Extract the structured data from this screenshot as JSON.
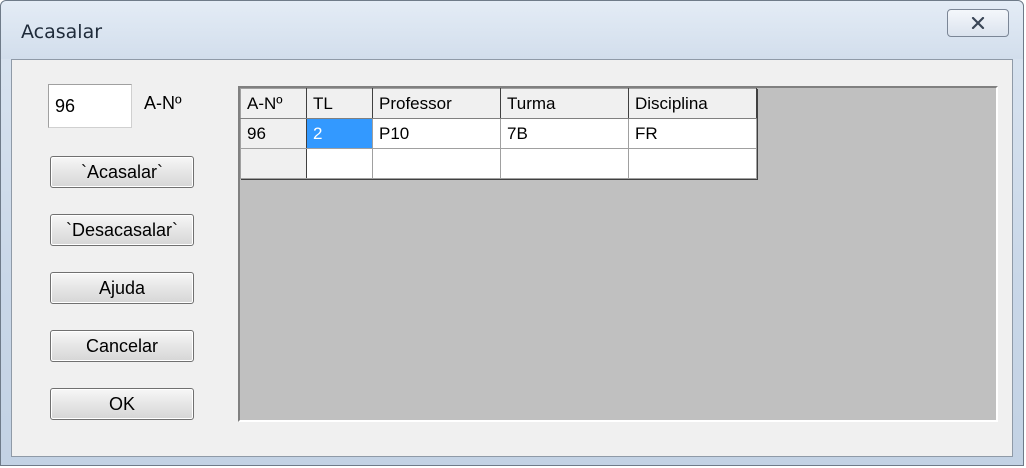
{
  "window": {
    "title": "Acasalar",
    "close_icon": "close-icon"
  },
  "an_field": {
    "value": "96",
    "label": "A-Nº"
  },
  "buttons": {
    "acasalar": "`Acasalar`",
    "desacasalar": "`Desacasalar`",
    "ajuda": "Ajuda",
    "cancelar": "Cancelar",
    "ok": "OK"
  },
  "grid": {
    "headers": [
      "A-Nº",
      "TL",
      "Professor",
      "Turma",
      "Disciplina"
    ],
    "rows": [
      [
        "96",
        "2",
        "P10",
        "7B",
        "FR"
      ],
      [
        "",
        "",
        "",
        "",
        ""
      ]
    ],
    "selected_cell": "TL of row 1"
  }
}
